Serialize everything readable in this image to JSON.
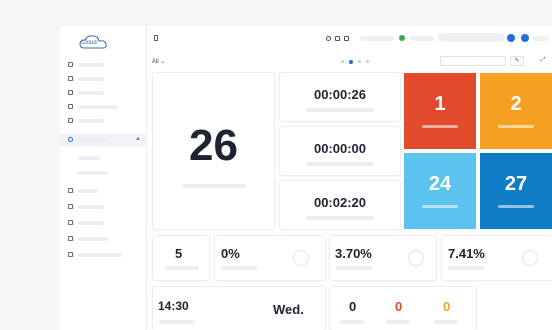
{
  "app": {
    "logo_text": "Cloud"
  },
  "filter": {
    "label": "All ⌄"
  },
  "toolbar": {
    "edit_icon": "✎",
    "expand_icon": "⤢"
  },
  "main_counter": {
    "value": "26"
  },
  "timers": [
    "00:00:26",
    "00:00:00",
    "00:02:20"
  ],
  "tiles": [
    {
      "value": "1",
      "color": "#e14a2b"
    },
    {
      "value": "2",
      "color": "#f5a021"
    },
    {
      "value": "24",
      "color": "#5cc3ef"
    },
    {
      "value": "27",
      "color": "#0f7cc6"
    }
  ],
  "stats": [
    {
      "value": "5"
    },
    {
      "value": "0%"
    },
    {
      "value": "3.70%"
    },
    {
      "value": "7.41%"
    }
  ],
  "clock": {
    "time": "14:30",
    "day": "Wed."
  },
  "counts": [
    {
      "value": "0",
      "color": "#1d2330"
    },
    {
      "value": "0",
      "color": "#e14a2b"
    },
    {
      "value": "0",
      "color": "#f5a021"
    }
  ]
}
